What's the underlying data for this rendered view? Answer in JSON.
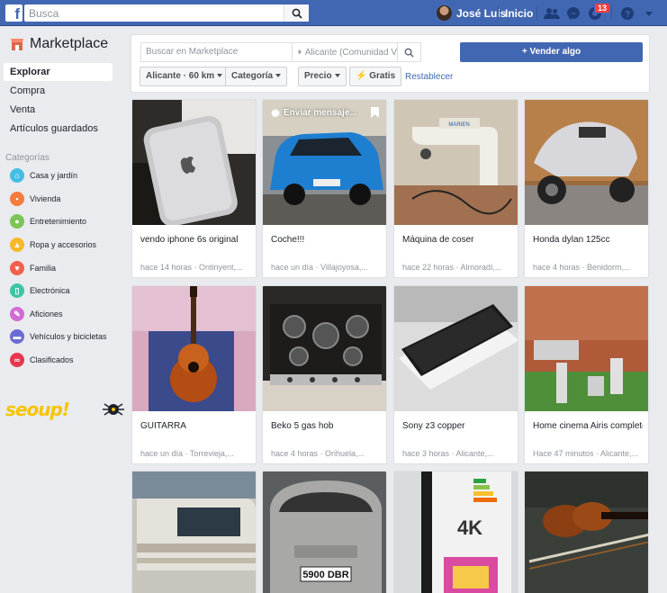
{
  "topbar": {
    "search_placeholder": "Busca",
    "user_name": "José Luis",
    "home_label": "Inicio",
    "notifications_count": "13",
    "icons": [
      "friends-icon",
      "messenger-icon",
      "notifications-icon",
      "help-icon",
      "caret-down-icon"
    ]
  },
  "sidebar": {
    "title": "Marketplace",
    "nav": [
      {
        "label": "Explorar",
        "active": true
      },
      {
        "label": "Compra"
      },
      {
        "label": "Venta"
      },
      {
        "label": "Artículos guardados"
      }
    ],
    "categories_heading": "Categorías",
    "categories": [
      {
        "label": "Casa y jardín",
        "color": "#45bde5",
        "icon": "house-icon"
      },
      {
        "label": "Vivienda",
        "color": "#f57c3b",
        "icon": "building-icon"
      },
      {
        "label": "Entretenimiento",
        "color": "#7bc456",
        "icon": "gamepad-icon"
      },
      {
        "label": "Ropa y accesorios",
        "color": "#f7b928",
        "icon": "hanger-icon"
      },
      {
        "label": "Familia",
        "color": "#f2614c",
        "icon": "heart-icon"
      },
      {
        "label": "Electrónica",
        "color": "#3fc4a6",
        "icon": "phone-icon"
      },
      {
        "label": "Aficiones",
        "color": "#d36bd6",
        "icon": "brush-icon"
      },
      {
        "label": "Vehículos y bicicletas",
        "color": "#6b6bd6",
        "icon": "car-icon"
      },
      {
        "label": "Clasificados",
        "color": "#e8364f",
        "icon": "binoculars-icon"
      }
    ],
    "logo_text": "seoup!"
  },
  "filters": {
    "search_placeholder": "Buscar en Marketplace",
    "location_placeholder": "Alicante (Comunidad V",
    "sell_label": "+ Vender algo",
    "location_chip": "Alicante · 60 km",
    "category_chip": "Categoría",
    "price_chip": "Precio",
    "free_chip": "Gratis",
    "reset_label": "Restablecer"
  },
  "listings": [
    {
      "title": "vendo iphone 6s original",
      "meta": "hace 14 horas · Ontinyent,..."
    },
    {
      "title": "Coche!!!",
      "meta": "hace un día · Villajoyosa,...",
      "overlay": "Enviar mensaje..."
    },
    {
      "title": "Máquina de coser",
      "meta": "hace 22 horas · Almoradí,..."
    },
    {
      "title": "Honda dylan 125cc",
      "meta": "hace 4 horas · Benidorm,..."
    },
    {
      "title": "GUITARRA",
      "meta": "hace un día · Torrevieja,..."
    },
    {
      "title": "Beko 5 gas hob",
      "meta": "hace 4 horas · Orihuela,..."
    },
    {
      "title": "Sony z3 copper",
      "meta": "hace 3 horas · Alicante,..."
    },
    {
      "title": "Home cinema Airis completo",
      "meta": "Hace 47 minutos · Alicante,..."
    },
    {
      "title": "",
      "meta": ""
    },
    {
      "title": "",
      "meta": "",
      "plate": "5900 DBR"
    },
    {
      "title": "",
      "meta": "",
      "tv_text": "4K"
    },
    {
      "title": "",
      "meta": ""
    }
  ]
}
